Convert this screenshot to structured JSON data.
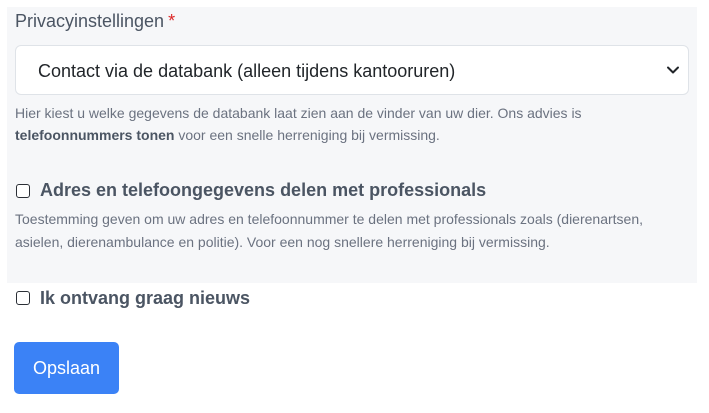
{
  "privacy": {
    "label": "Privacyinstellingen",
    "required_mark": "*",
    "select_value": "Contact via de databank (alleen tijdens kantooruren)",
    "help_part1": "Hier kiest u welke gegevens de databank laat zien aan de vinder van uw dier. Ons advies is",
    "help_bold": "telefoonnummers tonen",
    "help_part2": " voor een snelle herreniging bij vermissing."
  },
  "share_professionals": {
    "label": "Adres en telefoongegevens delen met professionals",
    "checked": false,
    "help_line1": "Toestemming geven om uw adres en telefoonnummer te delen met professionals zoals (dierenartsen,",
    "help_line2": "asielen, dierenambulance en politie). Voor een nog snellere herreniging bij vermissing."
  },
  "newsletter": {
    "label": "Ik ontvang graag nieuws",
    "checked": false
  },
  "actions": {
    "save_label": "Opslaan"
  },
  "colors": {
    "accent": "#3b82f6",
    "required": "#dc2626",
    "panel_bg": "#f6f7f9"
  },
  "icons": {
    "select_arrow": "chevron-down-icon"
  }
}
